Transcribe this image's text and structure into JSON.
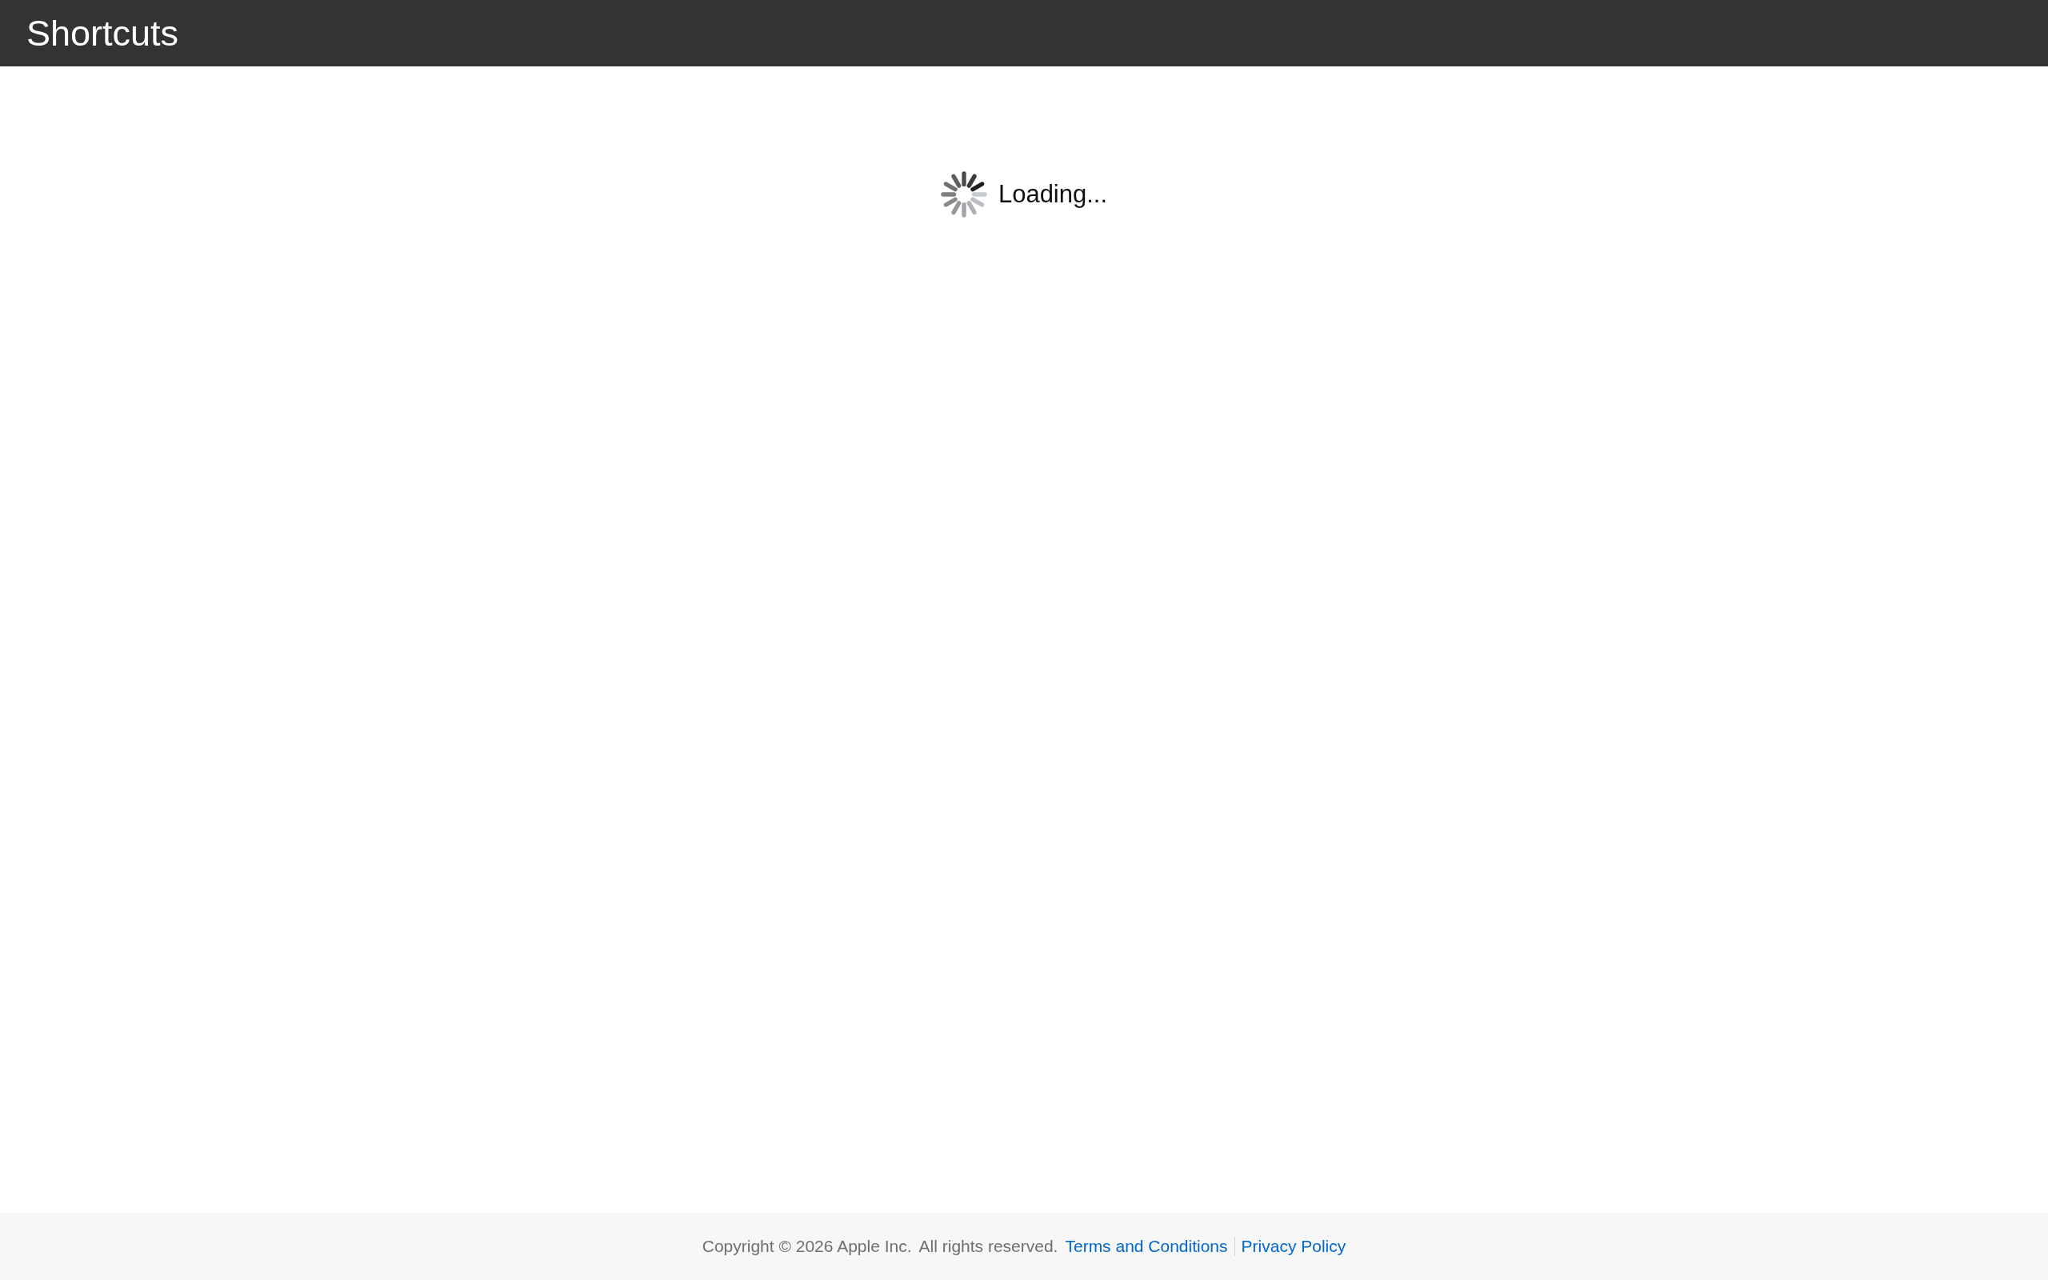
{
  "header": {
    "title": "Shortcuts"
  },
  "loading": {
    "text": "Loading..."
  },
  "footer": {
    "copyright": "Copyright © 2026 Apple Inc.",
    "rights": "All rights reserved.",
    "links": [
      {
        "label": "Terms and Conditions"
      },
      {
        "label": "Privacy Policy"
      }
    ]
  }
}
